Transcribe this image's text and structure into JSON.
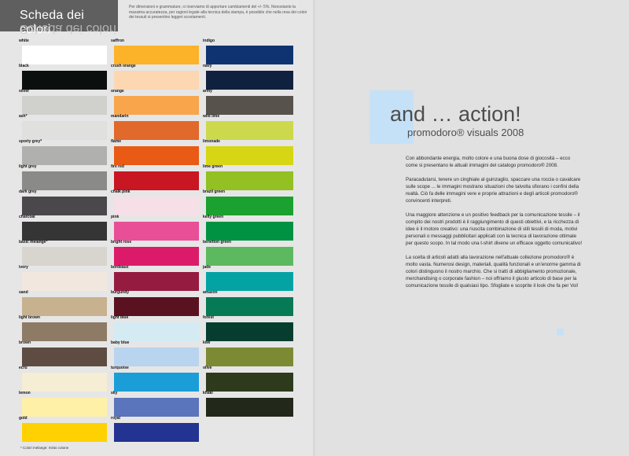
{
  "title": "Scheda dei colori",
  "note": "Per dimensioni e grammature, ci riserviamo di apportare cambiamenti del +/- 5%. Nonostante la massima accuratezza, per ragioni legate alla tecnica della stampa, è possibile che nella resa dei colori dei tessuti si presentino leggeri scostamenti.",
  "footnote": "* Colori melange: misto cotone",
  "columns": [
    [
      {
        "name": "white",
        "color": "#ffffff"
      },
      {
        "name": "black",
        "color": "#0b0f0e"
      },
      {
        "name": "silver",
        "color": "#d0d0cc"
      },
      {
        "name": "ash*",
        "color": "#e0e0de"
      },
      {
        "name": "sporty grey*",
        "color": "#b0b0ae"
      },
      {
        "name": "light grey",
        "color": "#8a8a88"
      },
      {
        "name": "dark grey",
        "color": "#4a484a"
      },
      {
        "name": "charcoal",
        "color": "#353535"
      },
      {
        "name": "basic melange*",
        "color": "#d8d4ce"
      },
      {
        "name": "ivory",
        "color": "#f1e7df"
      },
      {
        "name": "sand",
        "color": "#c7b18f"
      },
      {
        "name": "light brown",
        "color": "#8e7b66"
      },
      {
        "name": "brown",
        "color": "#5e4c42"
      },
      {
        "name": "ecru",
        "color": "#f5edd4"
      },
      {
        "name": "lemon",
        "color": "#fff0a8"
      },
      {
        "name": "gold",
        "color": "#ffd100"
      }
    ],
    [
      {
        "name": "saffron",
        "color": "#fcb32a"
      },
      {
        "name": "crush orange",
        "color": "#fcd7b1"
      },
      {
        "name": "orange",
        "color": "#f8a54b"
      },
      {
        "name": "mandarin",
        "color": "#e1692b"
      },
      {
        "name": "flame",
        "color": "#e95a14"
      },
      {
        "name": "fire red",
        "color": "#c81623"
      },
      {
        "name": "chalk pink",
        "color": "#f6dfe6"
      },
      {
        "name": "pink",
        "color": "#e94f96"
      },
      {
        "name": "bright rose",
        "color": "#db1b6a"
      },
      {
        "name": "bordeaux",
        "color": "#961b41"
      },
      {
        "name": "burgundy",
        "color": "#5a1220"
      },
      {
        "name": "light blue",
        "color": "#d4ebf3"
      },
      {
        "name": "baby blue",
        "color": "#b9d4ee"
      },
      {
        "name": "turquoise",
        "color": "#1b9dd8"
      },
      {
        "name": "sky",
        "color": "#5a75bb"
      },
      {
        "name": "royal",
        "color": "#233392"
      }
    ],
    [
      {
        "name": "indigo",
        "color": "#0f3370"
      },
      {
        "name": "navy",
        "color": "#10203f"
      },
      {
        "name": "army",
        "color": "#57524b"
      },
      {
        "name": "wild lime",
        "color": "#ccd94c"
      },
      {
        "name": "limonade",
        "color": "#d6d614"
      },
      {
        "name": "lime green",
        "color": "#93c022"
      },
      {
        "name": "brazil green",
        "color": "#1aa12f"
      },
      {
        "name": "kelly green",
        "color": "#009243"
      },
      {
        "name": "benetton green",
        "color": "#5db95f"
      },
      {
        "name": "jade",
        "color": "#03a3a3"
      },
      {
        "name": "amazon",
        "color": "#057a55"
      },
      {
        "name": "forest",
        "color": "#073d2f"
      },
      {
        "name": "kiwi",
        "color": "#7d8a34"
      },
      {
        "name": "olive",
        "color": "#2d3a1c"
      },
      {
        "name": "khaki",
        "color": "#23291a"
      }
    ]
  ],
  "headline": "and … action!",
  "subline": "promodoro® visuals 2008",
  "paragraphs": [
    "Con abbondante energia, molto colore e una buona dose di giocosità – ecco come si presentano le attuali immagini del catalogo promodoro® 2008.",
    "Paracadutarsi, tenere un cinghiale al guinzaglio, spaccare una roccia o cavalcare sulle scope ... le immagini mostrano situazioni che talvolta sfiorano i confini della realtà. Ciò fa delle immagini vere e proprie attrazioni e degli articoli promodoro® convincenti interpreti.",
    "Una maggiore attenzione e un positivo feedback per la comunicazione tessile – il compito dei nostri prodotti è il raggiungimento di questi obiettivi, e la ricchezza di idee è il motore creativo: una riuscita combinazione di stili tessili di moda, motivi personali o messaggi pubblicitari applicati con la tecnica di lavorazione ottimale per questo scopo. In tal modo una t-shirt divene un efficace oggetto comunicativo!",
    "La scelta di articoli adatti alla lavorazione nell'attuale collezione promodoro® è molto vasta. Numerosi design, materiali, qualità funzionali e un'enorme gamma di colori distinguono il nostro marchio. Che si tratti di abbigliamento promozionale, merchandising o corporate fashion – noi offriamo il giusto articolo di base per la comunicazione tessile di qualsiasi tipo. Sfogliate e scoprite il look che fa per Voi!"
  ],
  "accent_color": "#c5e1f7"
}
